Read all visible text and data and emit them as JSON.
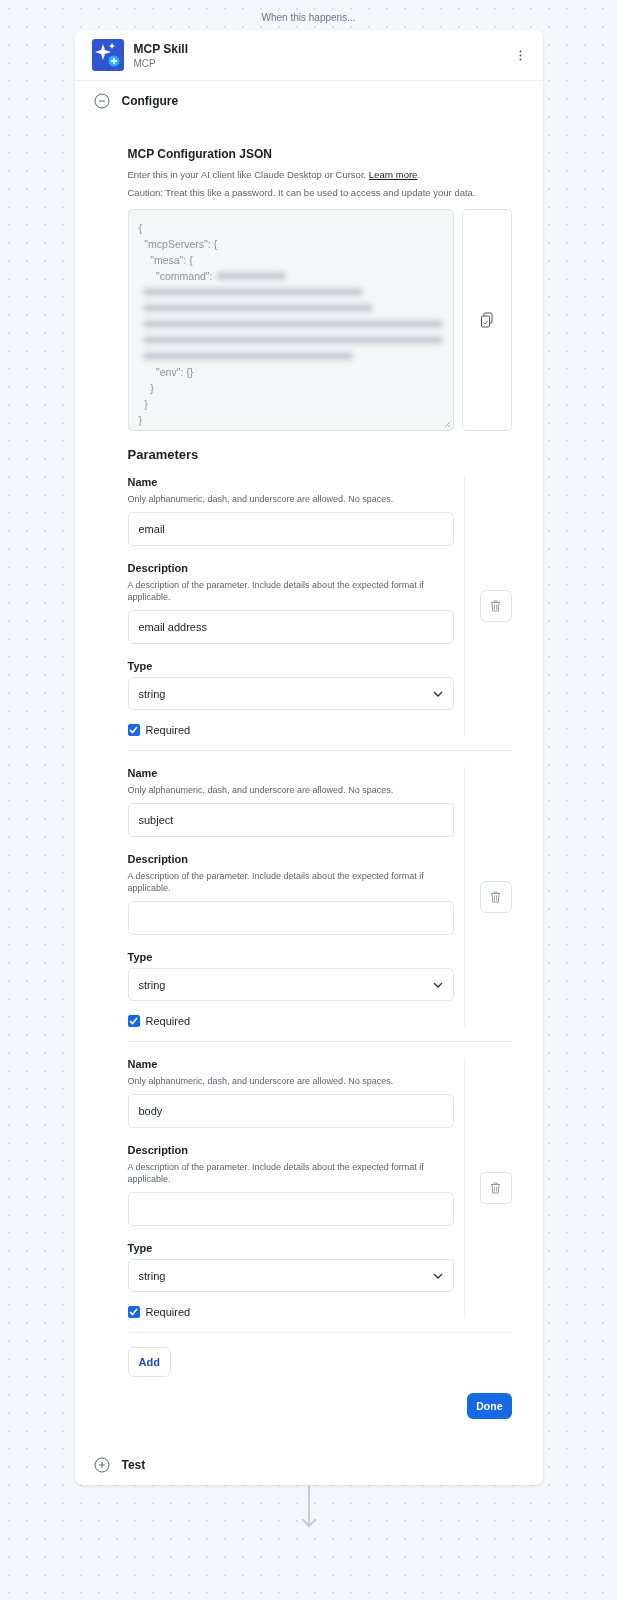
{
  "flow_label": "When this happens...",
  "step": {
    "title": "MCP Skill",
    "subtitle": "MCP"
  },
  "sections": [
    {
      "title": "Configure",
      "expanded": true
    },
    {
      "title": "Test",
      "expanded": false
    }
  ],
  "config": {
    "title": "MCP Configuration JSON",
    "intro": "Enter this in your AI client like Claude Desktop or Cursor.",
    "link": "Learn more",
    "link_suffix": ".",
    "caution": "Caution: Treat this like a password. It can be used to access and update your data.",
    "code_lines": [
      {
        "text": "{",
        "redacted": false
      },
      {
        "text": "  \"mcpServers\": {",
        "redacted": false
      },
      {
        "text": "    \"mesa\": {",
        "redacted": false
      },
      {
        "text": "      \"command\":",
        "redacted": true
      },
      {
        "redacted": true
      },
      {
        "redacted": true
      },
      {
        "redacted": true
      },
      {
        "redacted": true
      },
      {
        "redacted": true
      },
      {
        "text": "      \"env\": {}",
        "redacted": false
      },
      {
        "text": "    }",
        "redacted": false
      },
      {
        "text": "  }",
        "redacted": false
      },
      {
        "text": "}",
        "redacted": false
      }
    ]
  },
  "parameters": {
    "title": "Parameters",
    "items": [
      {
        "name_label": "Name",
        "name_hint": "Only alphanumeric, dash, and underscore are allowed. No spaces.",
        "name_value": "email",
        "desc_label": "Description",
        "desc_hint": "A description of the parameter. Include details about the expected format if applicable.",
        "desc_value": "email address",
        "type_label": "Type",
        "type_value": "string",
        "required_label": "Required",
        "required": true
      },
      {
        "name_label": "Name",
        "name_hint": "Only alphanumeric, dash, and underscore are allowed. No spaces.",
        "name_value": "subject",
        "desc_label": "Description",
        "desc_hint": "A description of the parameter. Include details about the expected format if applicable.",
        "type_label": "Type",
        "type_value": "string",
        "required_label": "Required",
        "required": true
      },
      {
        "name_label": "Name",
        "name_hint": "Only alphanumeric, dash, and underscore are allowed. No spaces.",
        "name_value": "body",
        "desc_label": "Description",
        "desc_hint": "A description of the parameter. Include details about the expected format if applicable.",
        "type_label": "Type",
        "type_value": "string",
        "required_label": "Required",
        "required": true
      }
    ]
  },
  "buttons": {
    "add": "Add",
    "done": "Done"
  }
}
